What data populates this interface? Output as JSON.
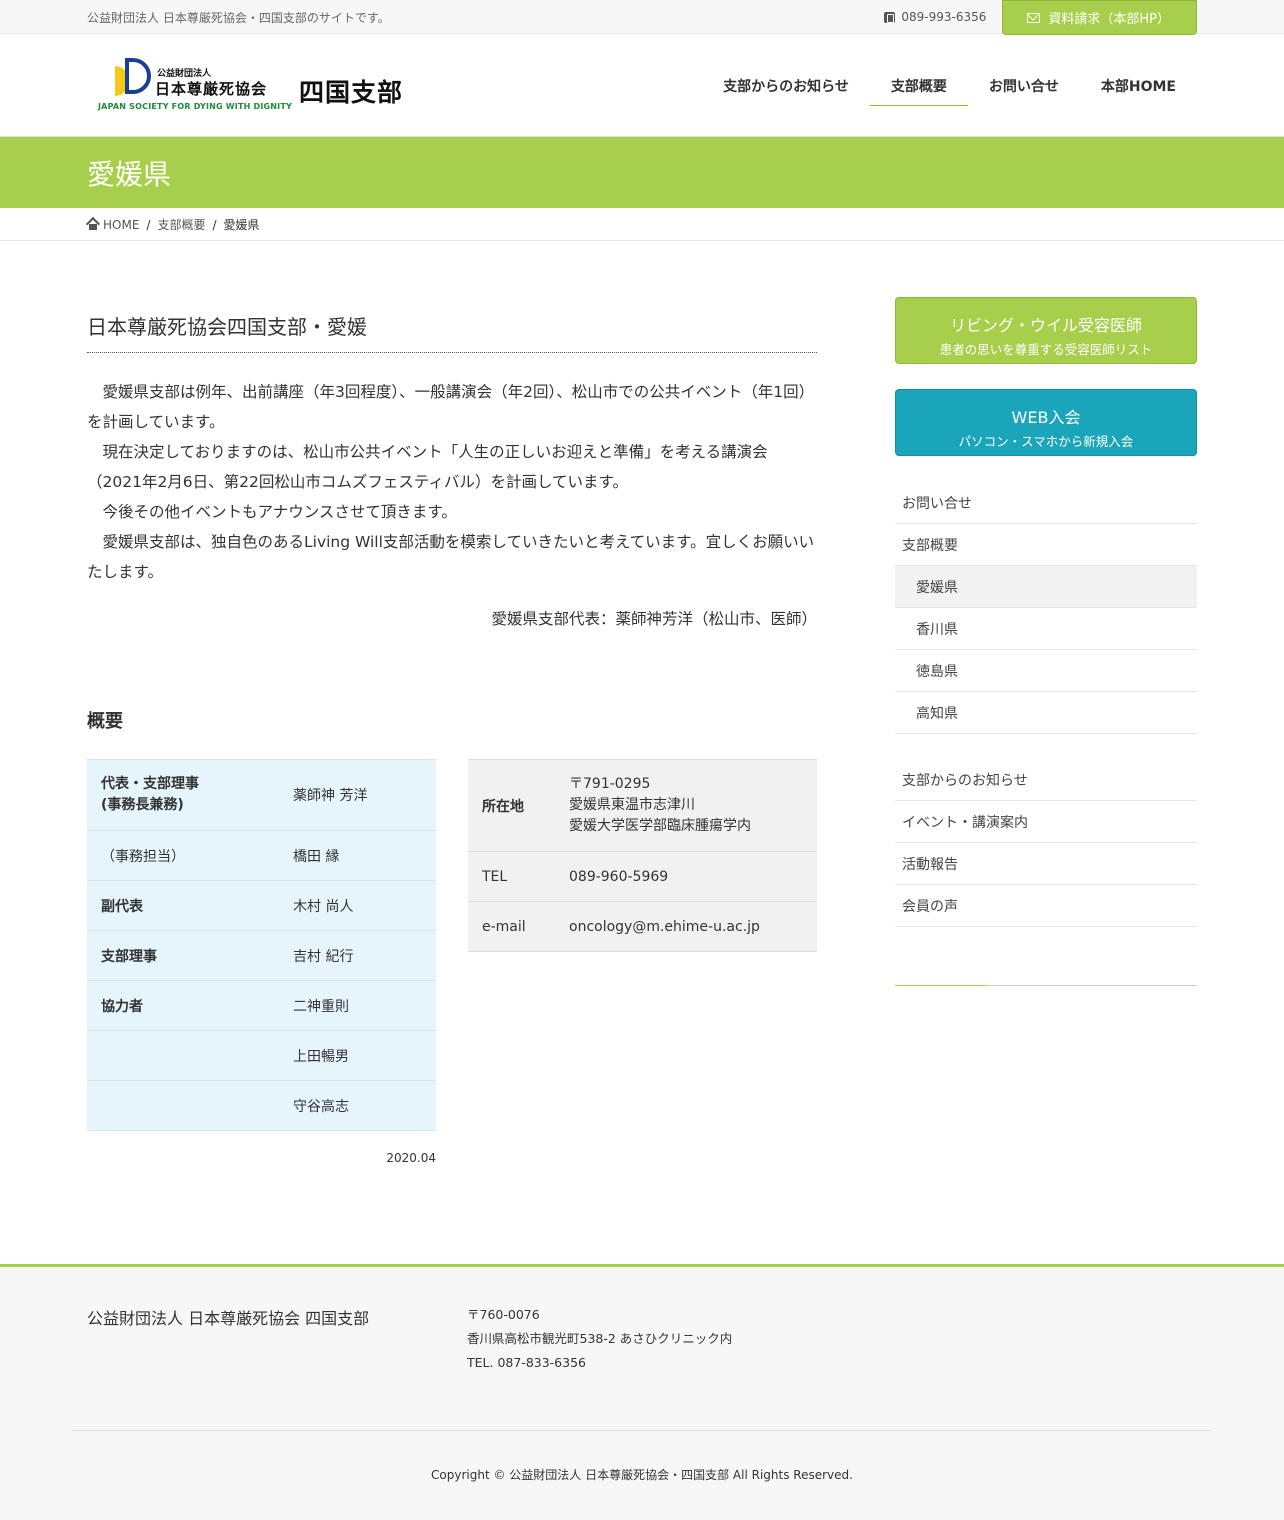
{
  "topbar": {
    "description": "公益財団法人 日本尊厳死協会・四国支部のサイトです。",
    "tel": "089-993-6356",
    "request_button": "資料請求（本部HP）"
  },
  "logo": {
    "small": "公益財団法人",
    "name": "日本尊厳死協会",
    "english": "JAPAN SOCIETY FOR DYING WITH DIGNITY",
    "branch": "四国支部"
  },
  "nav": {
    "items": [
      {
        "label": "支部からのお知らせ"
      },
      {
        "label": "支部概要"
      },
      {
        "label": "お問い合せ"
      },
      {
        "label": "本部HOME"
      }
    ]
  },
  "page": {
    "title": "愛媛県"
  },
  "breadcrumb": {
    "home": "HOME",
    "parent": "支部概要",
    "current": "愛媛県",
    "separator": "/"
  },
  "content": {
    "section_title": "日本尊厳死協会四国支部・愛媛",
    "paragraphs": [
      "愛媛県支部は例年、出前講座（年3回程度）、一般講演会（年2回）、松山市での公共イベント（年1回）を計画しています。",
      "現在決定しておりますのは、松山市公共イベント「人生の正しいお迎えと準備」を考える講演会（2021年2月6日、第22回松山市コムズフェスティバル）を計画しています。",
      "今後その他イベントもアナウンスさせて頂きます。",
      "愛媛県支部は、独自色のあるLiving Will支部活動を模索していきたいと考えています。宜しくお願いいたします。"
    ],
    "representative": "愛媛県支部代表：薬師神芳洋（松山市、医師）",
    "overview_title": "概要",
    "staff_table": [
      {
        "key_line1": "代表・支部理事",
        "key_line2": "(事務長兼務)",
        "value": "薬師神 芳洋"
      },
      {
        "key": "（事務担当）",
        "value": "橋田 縁"
      },
      {
        "key": "副代表",
        "value": "木村 尚人"
      },
      {
        "key": "支部理事",
        "value": "吉村 紀行"
      },
      {
        "key": "協力者",
        "value": "二神重則"
      },
      {
        "key": "",
        "value": "上田暢男"
      },
      {
        "key": "",
        "value": "守谷高志"
      }
    ],
    "contact_table": {
      "address_key": "所在地",
      "address_line1": "〒791-0295",
      "address_line2": "愛媛県東温市志津川",
      "address_line3": "愛媛大学医学部臨床腫瘍学内",
      "tel_key": "TEL",
      "tel_value": "089-960-5969",
      "email_key": "e-mail",
      "email_value": "oncology@m.ehime-u.ac.jp"
    },
    "date_note": "2020.04"
  },
  "sidebar": {
    "living_will_button": {
      "title": "リビング・ウイル受容医師",
      "subtitle": "患者の思いを尊重する受容医師リスト"
    },
    "web_join_button": {
      "title": "WEB入会",
      "subtitle": "パソコン・スマホから新規入会"
    },
    "menu1": [
      {
        "label": "お問い合せ"
      },
      {
        "label": "支部概要"
      },
      {
        "label": "愛媛県"
      },
      {
        "label": "香川県"
      },
      {
        "label": "徳島県"
      },
      {
        "label": "高知県"
      }
    ],
    "menu2": [
      {
        "label": "支部からのお知らせ"
      },
      {
        "label": "イベント・講演案内"
      },
      {
        "label": "活動報告"
      },
      {
        "label": "会員の声"
      }
    ]
  },
  "footer": {
    "org_name": "公益財団法人 日本尊厳死協会 四国支部",
    "postal": "〒760-0076",
    "address": "香川県高松市観光町538-2 あさひクリニック内",
    "tel": "TEL. 087-833-6356",
    "copyright": "Copyright © 公益財団法人 日本尊厳死協会・四国支部 All Rights Reserved."
  },
  "colors": {
    "accent_green": "#a8cf4c",
    "accent_blue": "#1aa5ba",
    "staff_table_bg": "#e6f4fc",
    "contact_table_bg": "#f1f1f1"
  },
  "icons": [
    "phone-icon",
    "mail-icon",
    "home-icon"
  ]
}
